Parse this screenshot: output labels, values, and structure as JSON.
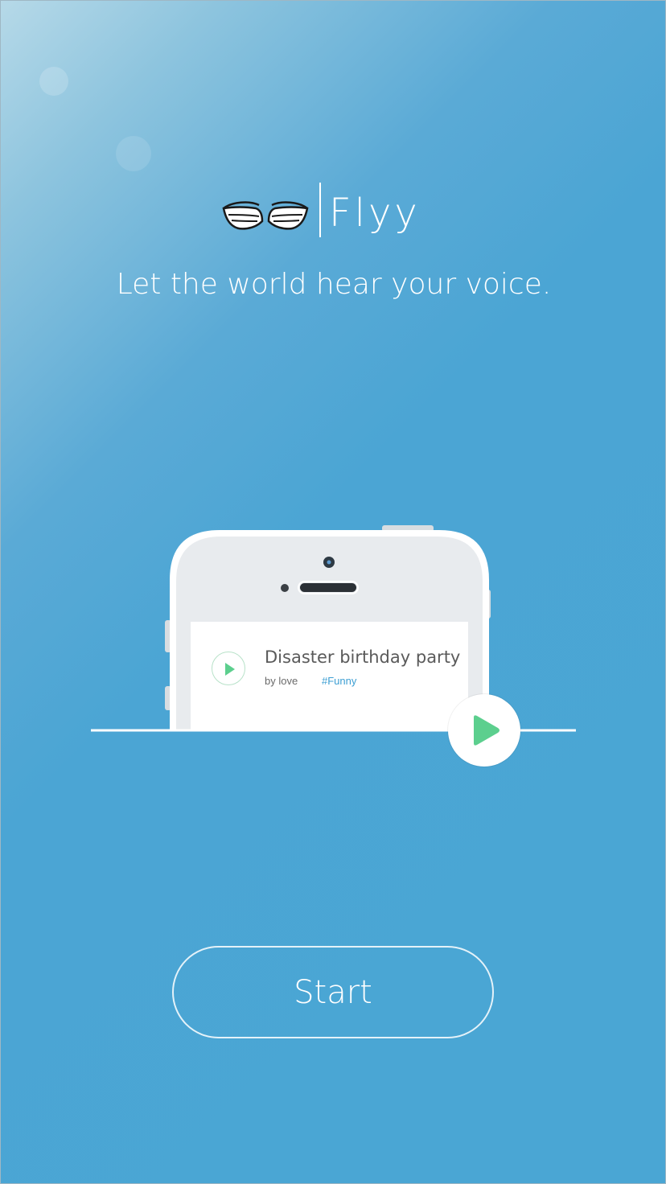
{
  "app": {
    "name": "Flyy",
    "tagline": "Let the world hear your voice."
  },
  "preview_card": {
    "title": "Disaster birthday party",
    "author": "by love",
    "tag": "#Funny"
  },
  "start_button": {
    "label": "Start"
  },
  "icons": {
    "logo": "wings-icon",
    "card_play": "play-icon",
    "big_play": "play-icon"
  },
  "colors": {
    "background": "#4aa6d4",
    "play_green": "#5ccf8e",
    "tag_blue": "#3d9fd3",
    "text_white": "#ffffff"
  }
}
